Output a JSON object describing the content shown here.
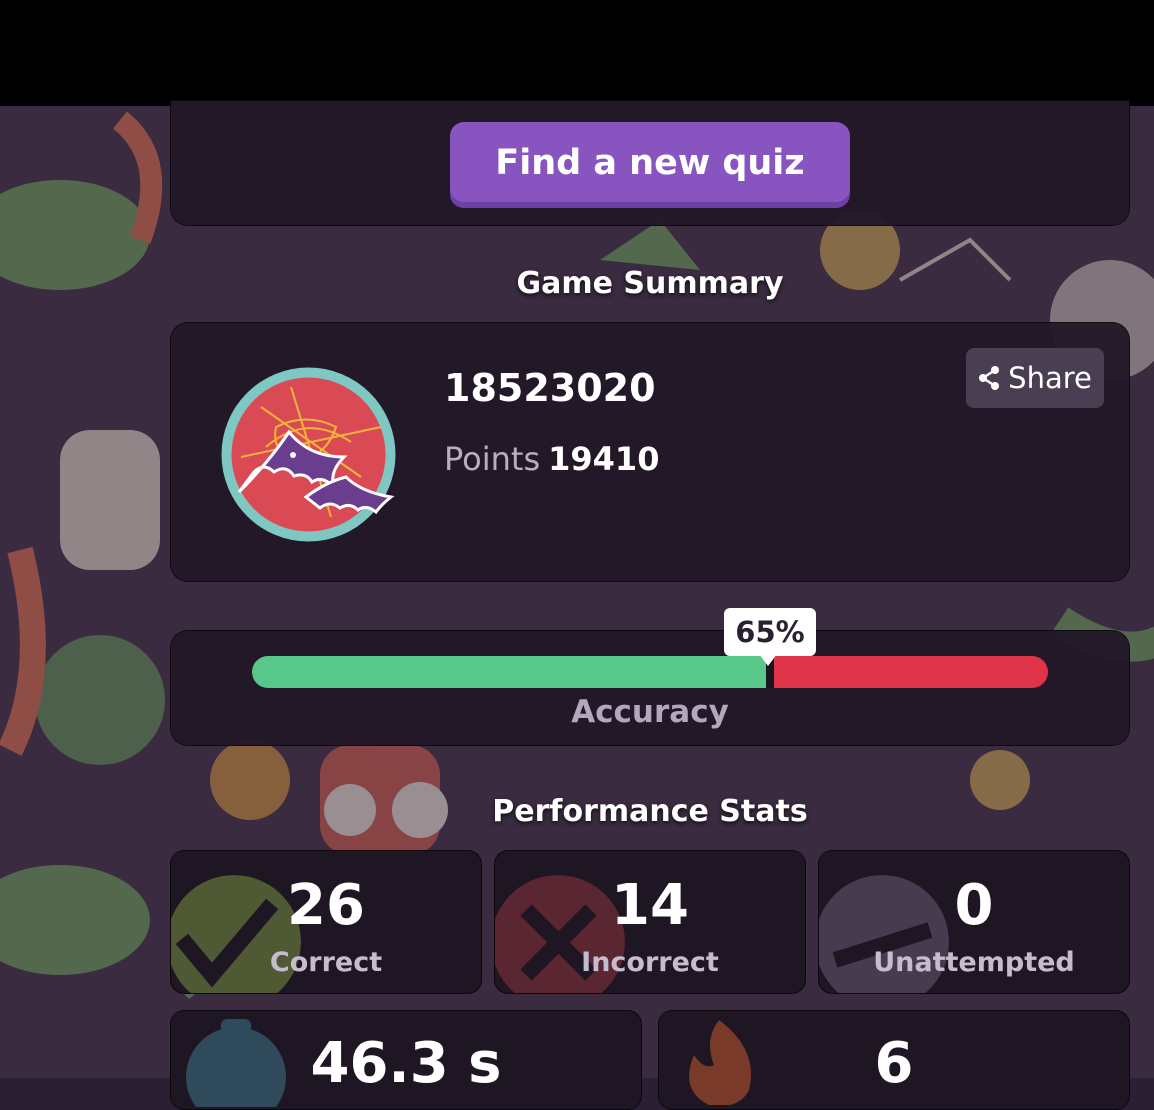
{
  "actions": {
    "find_quiz_label": "Find a new quiz"
  },
  "summary": {
    "title": "Game Summary",
    "player_name": "18523020",
    "points_label": "Points",
    "points_value": "19410",
    "share_label": "Share"
  },
  "accuracy": {
    "percent_label": "65%",
    "percent": 65,
    "label": "Accuracy"
  },
  "performance": {
    "title": "Performance Stats",
    "stats": [
      {
        "value": "26",
        "label": "Correct"
      },
      {
        "value": "14",
        "label": "Incorrect"
      },
      {
        "value": "0",
        "label": "Unattempted"
      }
    ],
    "time_value": "46.3 s",
    "streak_value": "6"
  },
  "colors": {
    "accent": "#8854c0",
    "correct": "#58c78a",
    "incorrect": "#e0344b",
    "background": "#2b1f33"
  }
}
